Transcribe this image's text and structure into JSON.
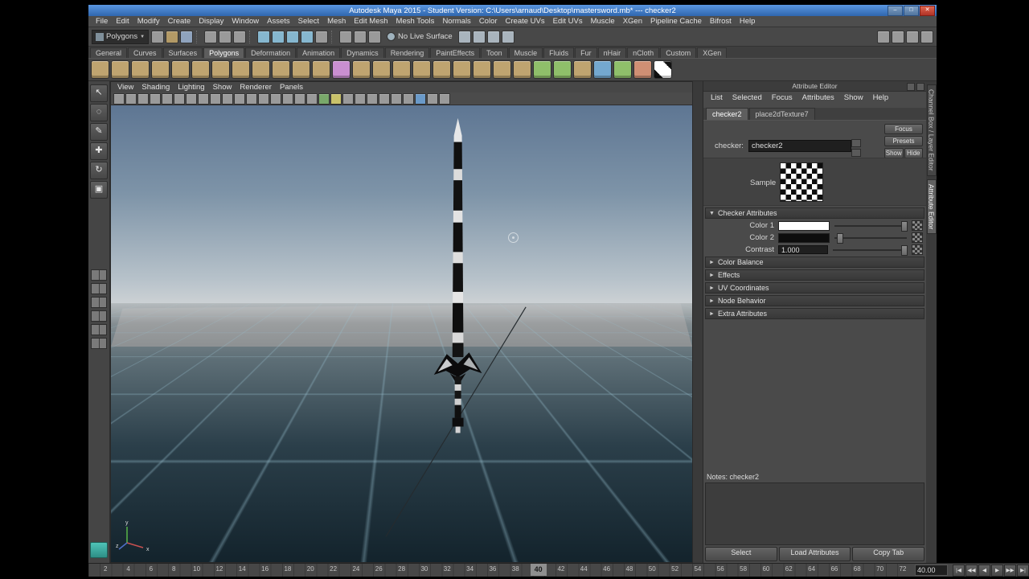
{
  "window": {
    "title": "Autodesk Maya 2015 - Student Version: C:\\Users\\arnaud\\Desktop\\mastersword.mb*  ---  checker2",
    "controls": [
      {
        "name": "minimize",
        "glyph": "–"
      },
      {
        "name": "maximize",
        "glyph": "□"
      },
      {
        "name": "close",
        "glyph": "✕"
      }
    ]
  },
  "icons": {
    "expanded": "▼",
    "collapsed": "►",
    "dropdown": "▼"
  },
  "menubar": {
    "items": [
      "File",
      "Edit",
      "Modify",
      "Create",
      "Display",
      "Window",
      "Assets",
      "Select",
      "Mesh",
      "Edit Mesh",
      "Mesh Tools",
      "Normals",
      "Color",
      "Create UVs",
      "Edit UVs",
      "Muscle",
      "XGen",
      "Pipeline Cache",
      "Bifrost",
      "Help"
    ]
  },
  "statusline": {
    "mode_label": "Polygons",
    "live_surface_label": "No Live Surface",
    "groups": [
      {
        "name": "scene",
        "icons": [
          {
            "n": "new-scene",
            "c": "#9a9a9a"
          },
          {
            "n": "open-scene",
            "c": "#b39a66"
          },
          {
            "n": "save-scene",
            "c": "#8fa3bd"
          }
        ]
      },
      {
        "name": "selection-masks",
        "icons": [
          {
            "n": "select-hierarchy",
            "c": "#9a9a9a"
          },
          {
            "n": "select-object",
            "c": "#9a9a9a"
          },
          {
            "n": "select-component",
            "c": "#9a9a9a"
          }
        ]
      },
      {
        "name": "snapping",
        "icons": [
          {
            "n": "snap-grid",
            "c": "#86b7cf"
          },
          {
            "n": "snap-curve",
            "c": "#86b7cf"
          },
          {
            "n": "snap-point",
            "c": "#86b7cf"
          },
          {
            "n": "snap-plane",
            "c": "#86b7cf"
          },
          {
            "n": "snap-surface",
            "c": "#9a9a9a"
          }
        ]
      },
      {
        "name": "history",
        "icons": [
          {
            "n": "input-connections",
            "c": "#9a9a9a"
          },
          {
            "n": "output-connections",
            "c": "#9a9a9a"
          },
          {
            "n": "construction-history",
            "c": "#9a9a9a"
          }
        ]
      }
    ],
    "render_group": [
      {
        "n": "open-render-view",
        "c": "#a9b4bd"
      },
      {
        "n": "render-current-frame",
        "c": "#a9b4bd"
      },
      {
        "n": "ipr-render",
        "c": "#a9b4bd"
      },
      {
        "n": "render-settings",
        "c": "#a9b4bd"
      }
    ],
    "right_icons": [
      {
        "n": "show-modeling-toolkit",
        "c": "#9a9a9a"
      },
      {
        "n": "show-channel-box",
        "c": "#9a9a9a"
      },
      {
        "n": "show-attribute-editor",
        "c": "#9a9a9a"
      },
      {
        "n": "show-tool-settings",
        "c": "#9a9a9a"
      }
    ]
  },
  "shelf": {
    "active_tab": "Polygons",
    "tabs": [
      "General",
      "Curves",
      "Surfaces",
      "Polygons",
      "Deformation",
      "Animation",
      "Dynamics",
      "Rendering",
      "PaintEffects",
      "Toon",
      "Muscle",
      "Fluids",
      "Fur",
      "nHair",
      "nCloth",
      "Custom",
      "XGen"
    ],
    "icons": [
      {
        "n": "poly-sphere",
        "c": "#bfa470"
      },
      {
        "n": "poly-cube",
        "c": "#bfa470"
      },
      {
        "n": "poly-cylinder",
        "c": "#bfa470"
      },
      {
        "n": "poly-cone",
        "c": "#bfa470"
      },
      {
        "n": "poly-plane",
        "c": "#bfa470"
      },
      {
        "n": "poly-torus",
        "c": "#bfa470"
      },
      {
        "n": "poly-prism",
        "c": "#bfa470"
      },
      {
        "n": "poly-pyramid",
        "c": "#bfa470"
      },
      {
        "n": "poly-pipe",
        "c": "#bfa470"
      },
      {
        "n": "poly-helix",
        "c": "#bfa470"
      },
      {
        "n": "poly-soccer-ball",
        "c": "#bfa470"
      },
      {
        "n": "poly-platonic",
        "c": "#bfa470"
      },
      {
        "n": "smooth",
        "c": "#c98fd1"
      },
      {
        "n": "combine",
        "c": "#bfa470"
      },
      {
        "n": "separate",
        "c": "#bfa470"
      },
      {
        "n": "extract",
        "c": "#bfa470"
      },
      {
        "n": "boolean-union",
        "c": "#bfa470"
      },
      {
        "n": "boolean-difference",
        "c": "#bfa470"
      },
      {
        "n": "boolean-intersect",
        "c": "#bfa470"
      },
      {
        "n": "extrude",
        "c": "#bfa470"
      },
      {
        "n": "bridge",
        "c": "#bfa470"
      },
      {
        "n": "append-to-polygon",
        "c": "#bfa470"
      },
      {
        "n": "insert-edge-loop",
        "c": "#8fbf6a"
      },
      {
        "n": "multi-cut",
        "c": "#8fbf6a"
      },
      {
        "n": "bevel",
        "c": "#bfa470"
      },
      {
        "n": "mirror-geometry",
        "c": "#74a8cf"
      },
      {
        "n": "quad-draw",
        "c": "#8fbf6a"
      },
      {
        "n": "sculpt-tool",
        "c": "#cf8f74"
      },
      {
        "n": "uv-checker-map",
        "c": "#e8e8e8",
        "checker": true
      }
    ]
  },
  "toolbox": {
    "tools": [
      {
        "name": "select-tool",
        "glyph": "↖"
      },
      {
        "name": "lasso-tool",
        "glyph": "◌"
      },
      {
        "name": "paint-select-tool",
        "glyph": "✎"
      },
      {
        "name": "move-tool",
        "glyph": "✚"
      },
      {
        "name": "rotate-tool",
        "glyph": "↻"
      },
      {
        "name": "scale-tool",
        "glyph": "▣"
      }
    ],
    "layouts": [
      {
        "name": "layout-single-pane"
      },
      {
        "name": "layout-four-pane"
      },
      {
        "name": "layout-persp-outliner"
      },
      {
        "name": "layout-two-pane-side"
      },
      {
        "name": "layout-two-pane-stacked"
      },
      {
        "name": "layout-hypershade-persp"
      }
    ]
  },
  "viewport": {
    "menus": [
      "View",
      "Shading",
      "Lighting",
      "Show",
      "Renderer",
      "Panels"
    ],
    "panel_icons": [
      {
        "n": "select-camera"
      },
      {
        "n": "lock-camera"
      },
      {
        "n": "camera-attributes"
      },
      {
        "n": "bookmarks"
      },
      {
        "n": "image-plane"
      },
      {
        "n": "two-d-pan-zoom"
      },
      {
        "n": "oversampling"
      },
      {
        "n": "grease-pencil"
      },
      {
        "n": "grid-toggle"
      },
      {
        "n": "film-gate"
      },
      {
        "n": "resolution-gate"
      },
      {
        "n": "gate-mask"
      },
      {
        "n": "field-chart"
      },
      {
        "n": "safe-action"
      },
      {
        "n": "safe-title"
      },
      {
        "n": "wireframe"
      },
      {
        "n": "shaded"
      },
      {
        "n": "textured",
        "c": "#79a86a"
      },
      {
        "n": "use-all-lights",
        "c": "#c9c26a"
      },
      {
        "n": "shadows"
      },
      {
        "n": "screen-space-ao"
      },
      {
        "n": "motion-blur"
      },
      {
        "n": "multisample-aa"
      },
      {
        "n": "depth-of-field"
      },
      {
        "n": "isolate-select"
      },
      {
        "n": "x-ray",
        "c": "#6a9ac9"
      },
      {
        "n": "exposure"
      },
      {
        "n": "gamma"
      }
    ]
  },
  "attribute_editor": {
    "title": "Attribute Editor",
    "menus": [
      "List",
      "Selected",
      "Focus",
      "Attributes",
      "Show",
      "Help"
    ],
    "tabs": [
      "checker2",
      "place2dTexture7"
    ],
    "active_tab": "checker2",
    "node_label": "checker:",
    "node_name": "checker2",
    "focus_button": "Focus",
    "presets_button": "Presets",
    "show_button": "Show",
    "hide_button": "Hide",
    "sample_label": "Sample",
    "expanded_section": "Checker Attributes",
    "attributes": {
      "color1_label": "Color 1",
      "color1_value": "#ffffff",
      "color2_label": "Color 2",
      "color2_value": "#0d0d0d",
      "contrast_label": "Contrast",
      "contrast_value": "1.000"
    },
    "collapsed_sections": [
      "Color Balance",
      "Effects",
      "UV Coordinates",
      "Node Behavior",
      "Extra Attributes"
    ],
    "notes_label": "Notes: checker2",
    "footer_buttons": [
      "Select",
      "Load Attributes",
      "Copy Tab"
    ]
  },
  "right_tabs": [
    {
      "label": "Channel Box / Layer Editor",
      "active": false
    },
    {
      "label": "Attribute Editor",
      "active": true
    }
  ],
  "timeline": {
    "start": 1,
    "end": 72,
    "label_step": 2,
    "current": 40,
    "time_field": "40.00",
    "playback": [
      {
        "name": "go-to-start",
        "glyph": "|◀"
      },
      {
        "name": "step-back-frame",
        "glyph": "◀◀"
      },
      {
        "name": "play-backward",
        "glyph": "◀"
      },
      {
        "name": "play-forward",
        "glyph": "▶"
      },
      {
        "name": "step-forward-frame",
        "glyph": "▶▶"
      },
      {
        "name": "go-to-end",
        "glyph": "▶|"
      }
    ]
  }
}
